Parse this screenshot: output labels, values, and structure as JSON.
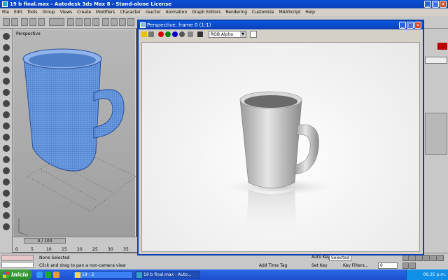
{
  "app": {
    "title": "19 b final.max - Autodesk 3ds Max 8 - Stand-alone License"
  },
  "menu": [
    "File",
    "Edit",
    "Tools",
    "Group",
    "Views",
    "Create",
    "Modifiers",
    "Character",
    "reactor",
    "Animation",
    "Graph Editors",
    "Rendering",
    "Customize",
    "MAXScript",
    "Help"
  ],
  "viewport": {
    "label": "Perspective"
  },
  "timeline": {
    "frame_counter": "0 / 100",
    "ticks": [
      "0",
      "5",
      "10",
      "15",
      "20",
      "25",
      "30",
      "35"
    ]
  },
  "status": {
    "selection": "None Selected",
    "hint": "Click and drag to pan a non-camera view",
    "add_time_tag": "Add Time Tag",
    "auto_key": "Auto Key",
    "selected": "Selected",
    "set_key": "Set Key",
    "key_filters": "Key Filters...",
    "frame_value": "0"
  },
  "render_window": {
    "title": "Perspective, frame 0 (1:1)",
    "channel": "RGB Alpha"
  },
  "taskbar": {
    "start": "Inicio",
    "tasks": [
      "19 - 2",
      "19 b final.max - Auto..."
    ],
    "clock": "06:35 p.m."
  },
  "colors": {
    "titlebar": "#0b3fb8",
    "taskbar": "#1c4fcc",
    "start": "#2c8a2c",
    "mesh": "#5d8fd6"
  }
}
